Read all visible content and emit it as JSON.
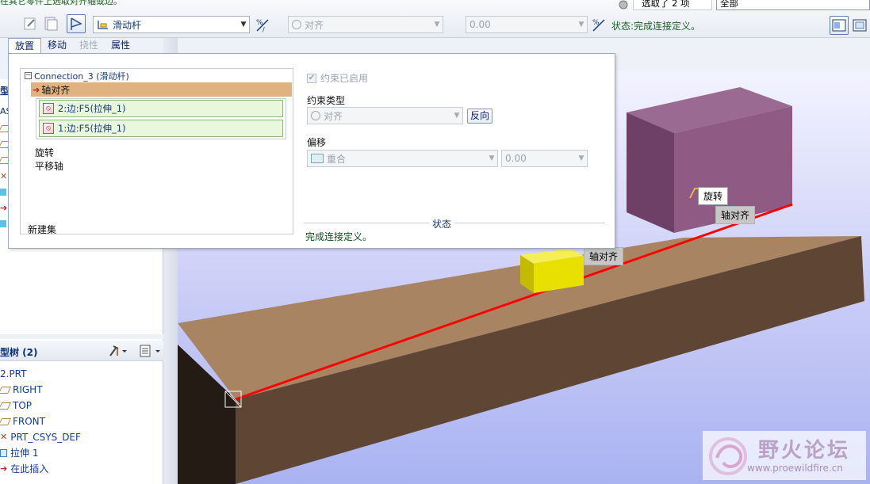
{
  "top_hint": "在其它零件上选取对齐轴或边。",
  "selection": {
    "count_text": "选取了 2 项",
    "filter_value": "全部"
  },
  "toolbar": {
    "connection_type": "滑动杆",
    "constraint_type": "对齐",
    "offset_value": "0.00",
    "status_label": "状态:",
    "status_text": "完成连接定义。"
  },
  "tabs": [
    {
      "label": "放置"
    },
    {
      "label": "移动"
    },
    {
      "label": "挠性"
    },
    {
      "label": "属性"
    }
  ],
  "dashboard": {
    "set_title": "Connection_3 (滑动杆)",
    "constraint_selected": "轴对齐",
    "refs": [
      "2:边:F5(拉伸_1)",
      "1:边:F5(拉伸_1)"
    ],
    "items": [
      "旋转",
      "平移轴"
    ],
    "new_set": "新建集",
    "enabled_label": "约束已启用",
    "constraint_type_label": "约束类型",
    "constraint_type_value": "对齐",
    "flip_button": "反向",
    "offset_label": "偏移",
    "offset_type_value": "重合",
    "offset_value": "0.00",
    "status_label": "状态",
    "status_text": "完成连接定义。"
  },
  "left_top_partial": [
    "型",
    "AS"
  ],
  "model_tree": {
    "title": "型树 (2)",
    "items": [
      {
        "label": "2.PRT",
        "icon": "part-icon"
      },
      {
        "label": "RIGHT",
        "icon": "datum-plane-icon"
      },
      {
        "label": "TOP",
        "icon": "datum-plane-icon"
      },
      {
        "label": "FRONT",
        "icon": "datum-plane-icon"
      },
      {
        "label": "PRT_CSYS_DEF",
        "icon": "csys-icon"
      },
      {
        "label": "拉伸 1",
        "icon": "extrude-icon"
      },
      {
        "label": "在此插入",
        "icon": "insert-arrow-icon"
      }
    ]
  },
  "viewport": {
    "callouts": [
      "旋转",
      "轴对齐",
      "轴对齐"
    ],
    "top_dots": "..."
  },
  "watermark": {
    "title": "野火论坛",
    "url": "www.proewildfire.cn"
  },
  "colors": {
    "purple_block": "#8f5b84",
    "brown_beam_top": "#a98463",
    "brown_beam_side": "#5f4634",
    "yellow_block": "#e8e000",
    "axis_line": "#ff0000",
    "sky_bottom": "#aab3f2"
  }
}
